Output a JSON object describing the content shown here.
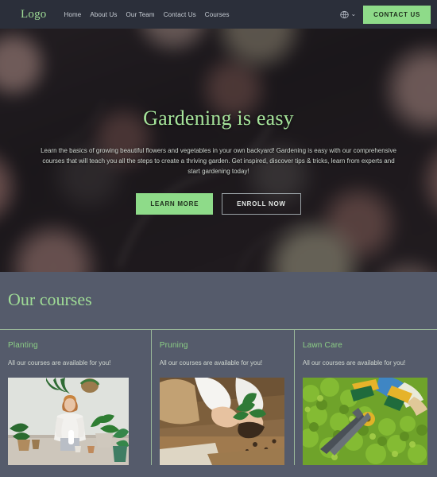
{
  "header": {
    "logo": "Logo",
    "nav": [
      {
        "label": "Home"
      },
      {
        "label": "About Us"
      },
      {
        "label": "Our Team"
      },
      {
        "label": "Contact Us"
      },
      {
        "label": "Courses"
      }
    ],
    "language_icon": "globe-icon",
    "language_chevron": "⌄",
    "contact_button": "CONTACT US"
  },
  "hero": {
    "title": "Gardening is easy",
    "subtitle": "Learn the basics of growing beautiful flowers and vegetables in your own backyard! Gardening is easy with our comprehensive courses that will teach you all the steps to create a thriving garden. Get inspired, discover tips & tricks, learn from experts and start gardening today!",
    "primary_button": "LEARN MORE",
    "secondary_button": "ENROLL NOW",
    "background_description": "blurred close-up of pink-tipped succulent rosettes, darkened"
  },
  "courses": {
    "heading": "Our courses",
    "items": [
      {
        "title": "Planting",
        "description": "All our courses are available for you!",
        "image_description": "woman potting plants at a table with houseplants"
      },
      {
        "title": "Pruning",
        "description": "All our courses are available for you!",
        "image_description": "hands repotting a small green plant with soil on a wooden table"
      },
      {
        "title": "Lawn Care",
        "description": "All our courses are available for you!",
        "image_description": "gardener trimming a green hedge with hedge shears"
      }
    ]
  },
  "colors": {
    "accent_green": "#8edb89",
    "heading_green": "#9fdc96",
    "header_bg": "#2b2f3a",
    "section_bg": "#555b6b",
    "divider": "#9ab89a",
    "body_text": "#cfd6d0"
  }
}
